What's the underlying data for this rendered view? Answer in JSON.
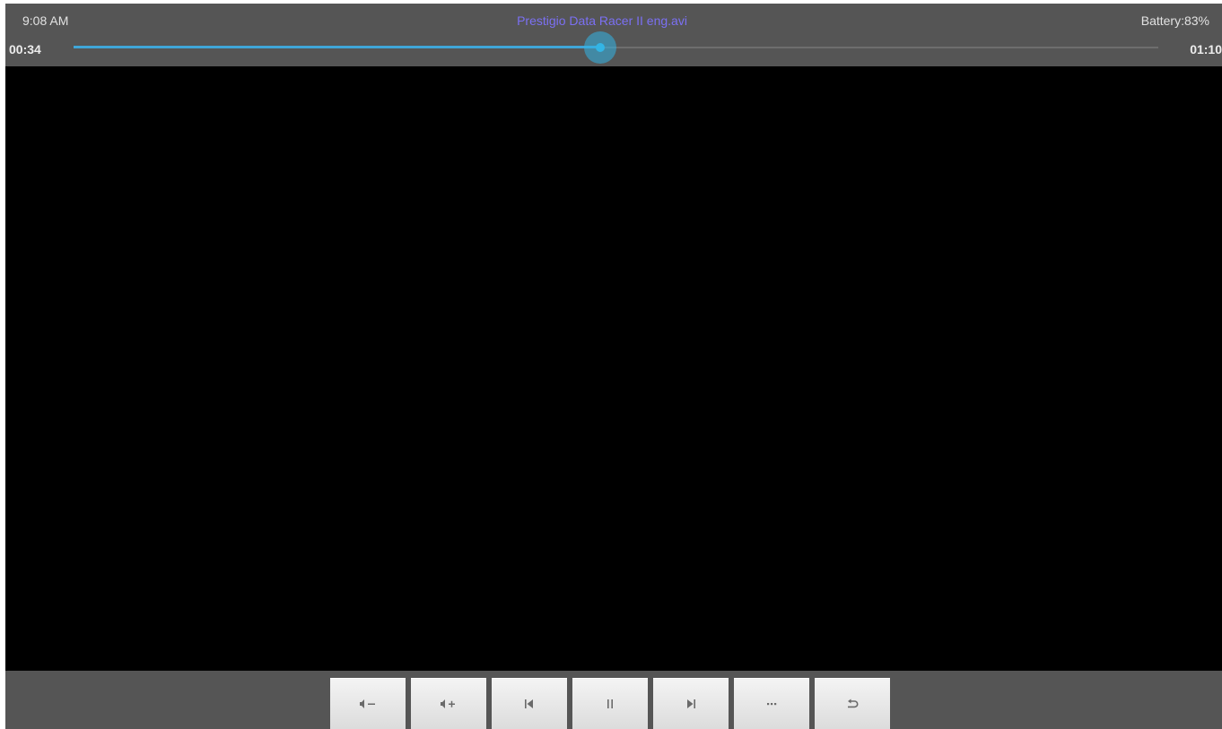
{
  "status": {
    "time": "9:08 AM",
    "title": "Prestigio Data Racer II eng.avi",
    "battery": "Battery:83%"
  },
  "playback": {
    "elapsed": "00:34",
    "duration": "01:10",
    "progress_fraction": 0.4857
  },
  "colors": {
    "accent": "#33b5e5",
    "title": "#7b70f3",
    "bar_background": "#555555"
  },
  "controls": [
    {
      "name": "volume-down-button",
      "icon": "volume-down-icon"
    },
    {
      "name": "volume-up-button",
      "icon": "volume-up-icon"
    },
    {
      "name": "previous-button",
      "icon": "skip-previous-icon"
    },
    {
      "name": "pause-button",
      "icon": "pause-icon"
    },
    {
      "name": "next-button",
      "icon": "skip-next-icon"
    },
    {
      "name": "more-button",
      "icon": "more-icon"
    },
    {
      "name": "back-button",
      "icon": "back-icon"
    }
  ]
}
